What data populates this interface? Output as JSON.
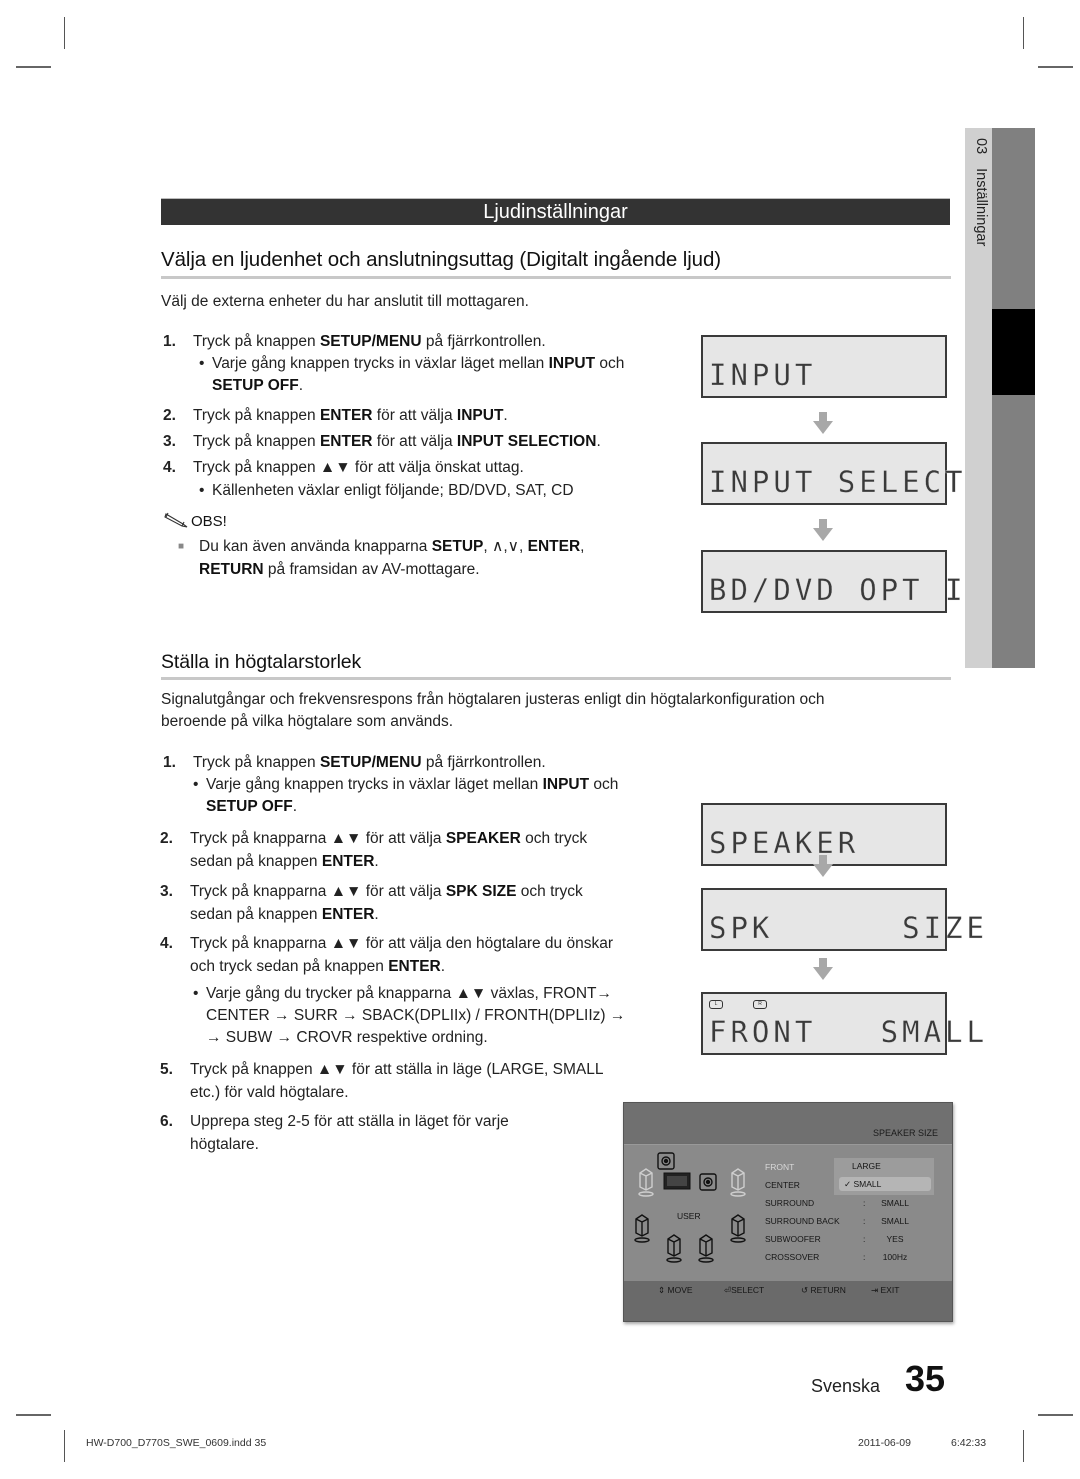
{
  "section_banner": "Ljudinställningar",
  "side_tab": {
    "chapter": "03",
    "label": "Inställningar"
  },
  "section1": {
    "heading": "Välja en ljudenhet och anslutningsuttag (Digitalt ingående ljud)",
    "intro": "Välj de externa enheter du har anslutit till mottagaren.",
    "steps": [
      {
        "num": "1.",
        "parts": [
          "Tryck på knappen ",
          "SETUP/MENU",
          " på fjärrkontrollen."
        ]
      },
      {
        "num": "2.",
        "parts": [
          "Tryck på knappen ",
          "ENTER",
          " för att välja ",
          "INPUT",
          "."
        ]
      },
      {
        "num": "3.",
        "parts": [
          "Tryck på knappen ",
          "ENTER",
          " för att välja ",
          "INPUT SELECTION",
          "."
        ]
      },
      {
        "num": "4.",
        "parts": [
          "Tryck på knappen ▲▼ för att välja önskat uttag."
        ]
      }
    ],
    "bullet1": {
      "line1": [
        "Varje gång knappen trycks in växlar läget mellan ",
        "INPUT",
        " och"
      ],
      "line2": [
        "SETUP OFF",
        "."
      ]
    },
    "bullet4": "Källenheten växlar enligt följande; BD/DVD, SAT, CD",
    "note_label": "OBS!",
    "note": {
      "line1": [
        "Du kan även använda knapparna ",
        "SETUP",
        ", ∧,∨, ",
        "ENTER",
        ","
      ],
      "line2": [
        "RETURN",
        " på framsidan av AV-mottagare."
      ]
    },
    "lcd_screens": [
      "INPUT",
      "INPUT SELECT",
      "BD/DVD OPT I"
    ]
  },
  "section2": {
    "heading": "Ställa in högtalarstorlek",
    "intro_line1": "Signalutgångar och frekvensrespons från högtalaren justeras enligt din högtalarkonfiguration och",
    "intro_line2": "beroende på vilka högtalare som används.",
    "steps": {
      "s1": {
        "num": "1.",
        "parts": [
          "Tryck på knappen ",
          "SETUP/MENU",
          " på fjärrkontrollen."
        ]
      },
      "s1_bullet": {
        "line1": [
          "Varje gång knappen trycks in växlar läget mellan ",
          "INPUT",
          " och"
        ],
        "line2": [
          "SETUP OFF",
          "."
        ]
      },
      "s2": {
        "num": "2.",
        "line1": [
          "Tryck på knapparna ▲▼ för att välja ",
          "SPEAKER",
          " och tryck"
        ],
        "line2": [
          "sedan på knappen ",
          "ENTER",
          "."
        ]
      },
      "s3": {
        "num": "3.",
        "line1": [
          "Tryck på knapparna ▲▼ för att välja ",
          "SPK SIZE",
          " och tryck"
        ],
        "line2": [
          "sedan på knappen ",
          "ENTER",
          "."
        ]
      },
      "s4": {
        "num": "4.",
        "line1": [
          "Tryck på knapparna ▲▼ för att välja den högtalare du önskar"
        ],
        "line2": [
          "och tryck sedan på knappen ",
          "ENTER",
          "."
        ]
      },
      "s4_bullet": {
        "line1": "Varje gång du trycker på knapparna  ▲▼ växlas, FRONT→",
        "line2": "CENTER → SURR → SBACK(DPLIIx) / FRONTH(DPLIIz) →",
        "line3": "→ SUBW → CROVR respektive ordning."
      },
      "s5": {
        "num": "5.",
        "line1": "Tryck på knappen ▲▼ för att ställa in läge (LARGE, SMALL",
        "line2": "etc.) för vald högtalare."
      },
      "s6": {
        "num": "6.",
        "line1": "Upprepa steg 2-5 för att ställa in läget för varje",
        "line2": "högtalare."
      }
    },
    "lcd_screens": [
      "SPEAKER",
      "SPK      SIZE",
      "FRONT   SMALL"
    ],
    "lcd_indicators": [
      "L",
      "R"
    ],
    "osd": {
      "title": "SPEAKER SIZE",
      "layout_label": "USER",
      "rows": [
        {
          "label": "FRONT",
          "value": ""
        },
        {
          "label": "CENTER",
          "value": ""
        },
        {
          "label": "SURROUND",
          "value": "SMALL"
        },
        {
          "label": "SURROUND BACK",
          "value": "SMALL"
        },
        {
          "label": "SUBWOOFER",
          "value": "YES"
        },
        {
          "label": "CROSSOVER",
          "value": "100Hz"
        }
      ],
      "dropdown": {
        "options": [
          "LARGE",
          "✓ SMALL"
        ],
        "selected": "SMALL"
      },
      "footer": [
        {
          "icon": "updown-icon",
          "glyph": "⇕",
          "label": "MOVE"
        },
        {
          "icon": "enter-icon",
          "glyph": "⏎",
          "label": "SELECT"
        },
        {
          "icon": "return-icon",
          "glyph": "↺",
          "label": "RETURN"
        },
        {
          "icon": "exit-icon",
          "glyph": "⇥",
          "label": "EXIT"
        }
      ]
    }
  },
  "footer": {
    "language": "Svenska",
    "page_number": "35",
    "slug_file": "HW-D700_D770S_SWE_0609.indd   35",
    "slug_date": "2011-06-09",
    "slug_time": "6:42:33"
  }
}
